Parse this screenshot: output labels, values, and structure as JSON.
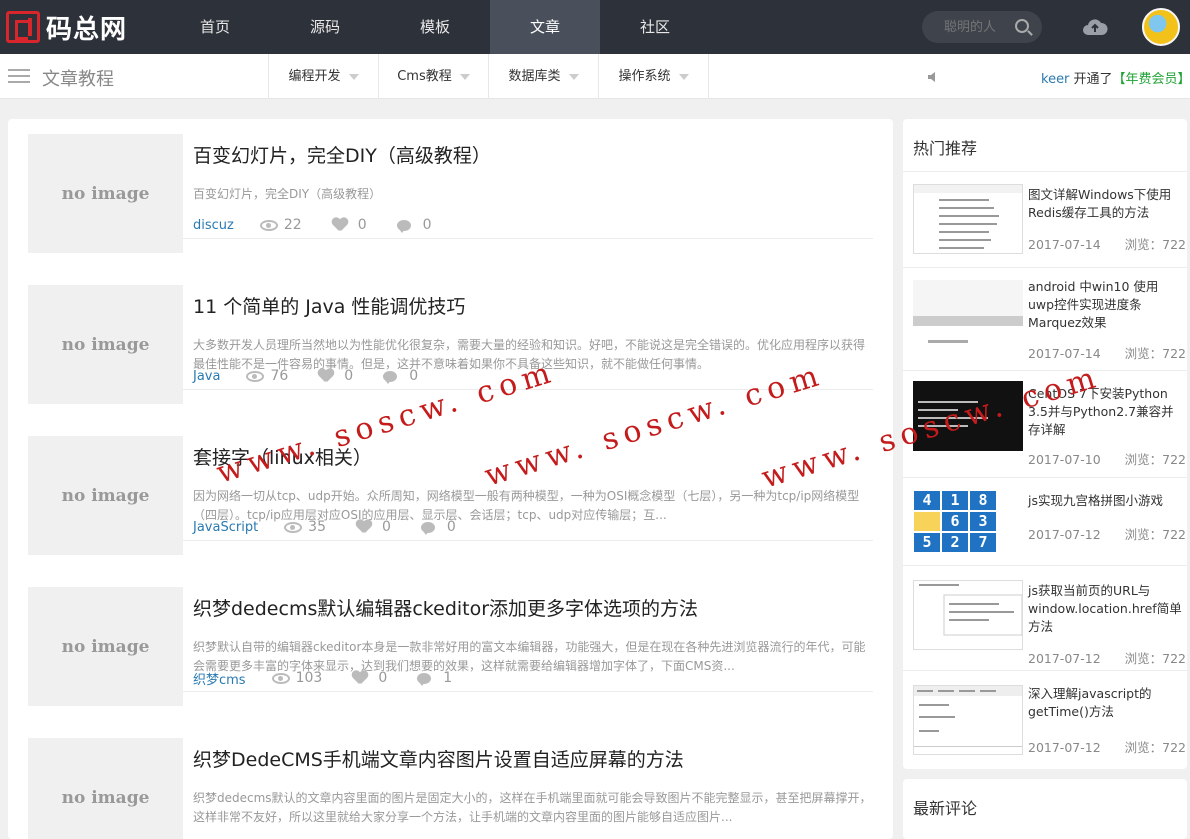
{
  "header": {
    "logo_text": "码总网",
    "nav": [
      "首页",
      "源码",
      "模板",
      "文章",
      "社区"
    ],
    "active_nav": "文章",
    "search_placeholder": "聪明的人"
  },
  "subbar": {
    "section_title": "文章教程",
    "menus": [
      "编程开发",
      "Cms教程",
      "数据库类",
      "操作系统"
    ],
    "notice_user": "keer",
    "notice_text": " 开通了",
    "notice_badge": "【年费会员】"
  },
  "articles": [
    {
      "thumb": "no image",
      "title": "百变幻灯片，完全DIY（高级教程）",
      "desc": "百变幻灯片，完全DIY（高级教程）",
      "category": "discuz",
      "views": "22",
      "likes": "0",
      "comments": "0"
    },
    {
      "thumb": "no image",
      "title": "11 个简单的 Java 性能调优技巧",
      "desc": "大多数开发人员理所当然地以为性能优化很复杂，需要大量的经验和知识。好吧，不能说这是完全错误的。优化应用程序以获得最佳性能不是一件容易的事情。但是，这并不意味着如果你不具备这些知识，就不能做任何事情。",
      "category": "Java",
      "views": "76",
      "likes": "0",
      "comments": "0"
    },
    {
      "thumb": "no image",
      "title": "套接字（linux相关）",
      "desc": "因为网络一切从tcp、udp开始。众所周知，网络模型一般有两种模型，一种为OSI概念模型（七层），另一种为tcp/ip网络模型（四层）。tcp/ip应用层对应OSI的应用层、显示层、会话层；tcp、udp对应传输层；互...",
      "category": "JavaScript",
      "views": "35",
      "likes": "0",
      "comments": "0"
    },
    {
      "thumb": "no image",
      "title": "织梦dedecms默认编辑器ckeditor添加更多字体选项的方法",
      "desc": "织梦默认自带的编辑器ckeditor本身是一款非常好用的富文本编辑器，功能强大，但是在现在各种先进浏览器流行的年代，可能会需要更多丰富的字体来显示，达到我们想要的效果，这样就需要给编辑器增加字体了，下面CMS资...",
      "category": "织梦cms",
      "views": "103",
      "likes": "0",
      "comments": "1"
    },
    {
      "thumb": "no image",
      "title": "织梦DedeCMS手机端文章内容图片设置自适应屏幕的方法",
      "desc": "织梦dedecms默认的文章内容里面的图片是固定大小的，这样在手机端里面就可能会导致图片不能完整显示，甚至把屏幕撑开，这样非常不友好，所以这里就给大家分享一个方法，让手机端的文章内容里面的图片能够自适应图片...",
      "category": "",
      "views": "",
      "likes": "",
      "comments": ""
    }
  ],
  "sidebar": {
    "title": "热门推荐",
    "items": [
      {
        "title": "图文详解Windows下使用Redis缓存工具的方法",
        "date": "2017-07-14",
        "views": "浏览：722"
      },
      {
        "title": "android 中win10 使用uwp控件实现进度条Marquez效果",
        "date": "2017-07-14",
        "views": "浏览：722"
      },
      {
        "title": "CentOS 7下安装Python 3.5并与Python2.7兼容并存详解",
        "date": "2017-07-10",
        "views": "浏览：722"
      },
      {
        "title": "js实现九宫格拼图小游戏",
        "date": "2017-07-12",
        "views": "浏览：722"
      },
      {
        "title": "js获取当前页的URL与window.location.href简单方法",
        "date": "2017-07-12",
        "views": "浏览：722"
      },
      {
        "title": "深入理解javascript的getTime()方法",
        "date": "2017-07-12",
        "views": "浏览：722"
      }
    ],
    "puzzle": [
      "4",
      "1",
      "8",
      "",
      "6",
      "3",
      "5",
      "2",
      "7"
    ]
  },
  "sidebar2": {
    "title": "最新评论"
  },
  "watermark": [
    "www. soscw. com",
    "www. soscw. com",
    "www. soscw. com"
  ]
}
